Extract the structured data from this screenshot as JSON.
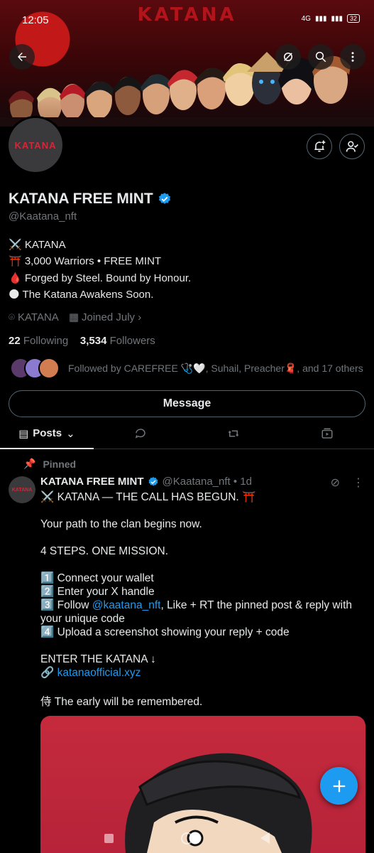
{
  "status": {
    "time": "12:05",
    "battery": "32",
    "signal": "4G"
  },
  "banner": {
    "wordmark": "KATANA"
  },
  "profile": {
    "avatar_text": "KATANA",
    "name": "KATANA FREE MINT",
    "handle": "@Kaatana_nft",
    "bio": [
      "⚔️ KATANA",
      "⛩️ 3,000 Warriors • FREE MINT",
      "🩸 Forged by Steel. Bound by Honour.",
      "🌑 The Katana Awakens Soon."
    ],
    "location": "KATANA",
    "joined": "Joined July",
    "following_count": "22",
    "following_label": "Following",
    "followers_count": "3,534",
    "followers_label": "Followers",
    "followed_by": "Followed by CAREFREE 🩺🤍, Suhail, Preacher🧣, and 17 others",
    "message_label": "Message"
  },
  "tabs": [
    {
      "label": "Posts"
    }
  ],
  "post": {
    "pinned_label": "Pinned",
    "author_name": "KATANA FREE MINT",
    "author_handle_time": "@Kaatana_nft • 1d",
    "avatar_text": "KATANA",
    "line1": "⚔️ KATANA — THE CALL HAS BEGUN. ⛩️",
    "line2": "Your path to the clan begins now.",
    "line3": "4 STEPS. ONE MISSION.",
    "step1": "1️⃣ Connect your wallet",
    "step2": "2️⃣ Enter your X handle",
    "step3_pre": "3️⃣ Follow ",
    "step3_link": "@kaatana_nft",
    "step3_post": ", Like + RT the pinned post & reply with your unique code",
    "step4": "4️⃣ Upload a screenshot showing your reply + code",
    "enter": "ENTER THE KATANA ↓",
    "link_icon": "🔗 ",
    "link": "katanaofficial.xyz",
    "closing": "侍 The early will be remembered."
  },
  "colors": {
    "accent": "#1d9bf0",
    "brand_red": "#d1283a",
    "muted": "#71767b"
  }
}
